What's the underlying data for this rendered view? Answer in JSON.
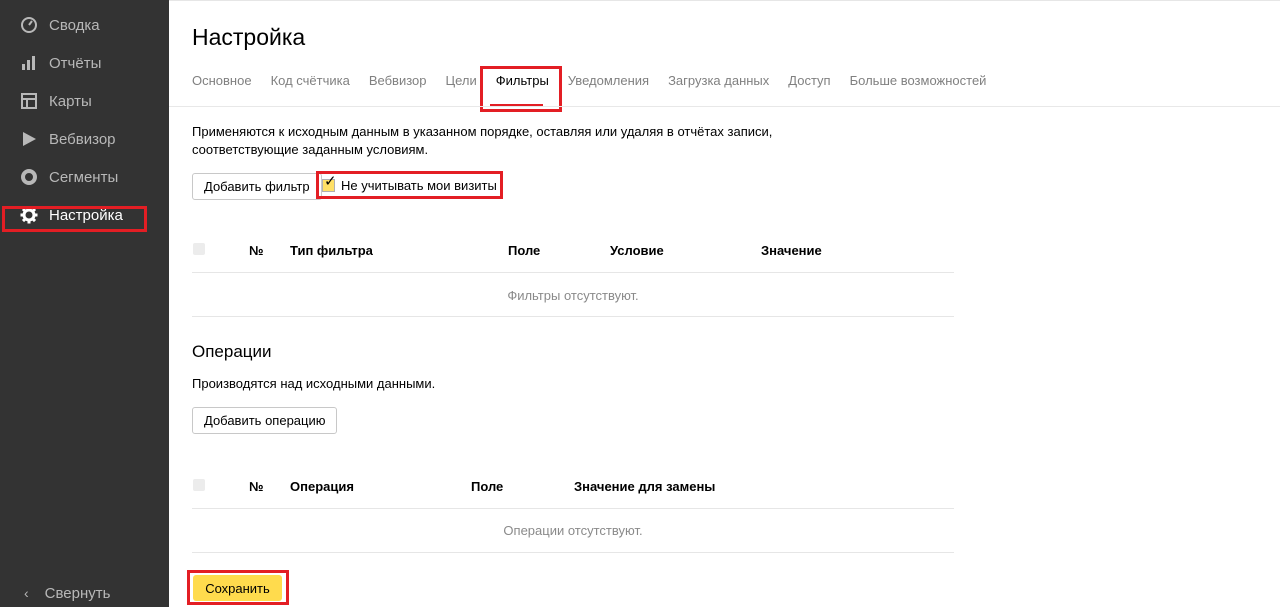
{
  "sidebar": {
    "items": [
      {
        "label": "Сводка",
        "icon": "gauge-icon"
      },
      {
        "label": "Отчёты",
        "icon": "bar-chart-icon"
      },
      {
        "label": "Карты",
        "icon": "map-icon"
      },
      {
        "label": "Вебвизор",
        "icon": "play-icon"
      },
      {
        "label": "Сегменты",
        "icon": "segments-ring-icon"
      },
      {
        "label": "Настройка",
        "icon": "gear-icon"
      }
    ],
    "collapse_label": "Свернуть",
    "collapse_icon": "‹"
  },
  "page": {
    "title": "Настройка"
  },
  "tabs": [
    {
      "label": "Основное"
    },
    {
      "label": "Код счётчика"
    },
    {
      "label": "Вебвизор"
    },
    {
      "label": "Цели"
    },
    {
      "label": "Фильтры"
    },
    {
      "label": "Уведомления"
    },
    {
      "label": "Загрузка данных"
    },
    {
      "label": "Доступ"
    },
    {
      "label": "Больше возможностей"
    }
  ],
  "filters": {
    "description_line1": "Применяются к исходным данным в указанном порядке, оставляя или удаляя в отчётах записи,",
    "description_line2": "соответствующие заданным условиям.",
    "add_button": "Добавить фильтр",
    "checkbox_label": "Не учитывать мои визиты",
    "checkbox_tick": "✓",
    "columns": [
      "№",
      "Тип фильтра",
      "Поле",
      "Условие",
      "Значение"
    ],
    "empty_text": "Фильтры отсутствуют."
  },
  "operations": {
    "title": "Операции",
    "description": "Производятся над исходными данными.",
    "add_button": "Добавить операцию",
    "columns": [
      "№",
      "Операция",
      "Поле",
      "Значение для замены"
    ],
    "empty_text": "Операции отсутствуют."
  },
  "save_button": "Сохранить",
  "colors": {
    "sidebar_bg": "#333333",
    "accent_yellow": "#ffdb4d",
    "highlight_red": "#e31e24"
  }
}
